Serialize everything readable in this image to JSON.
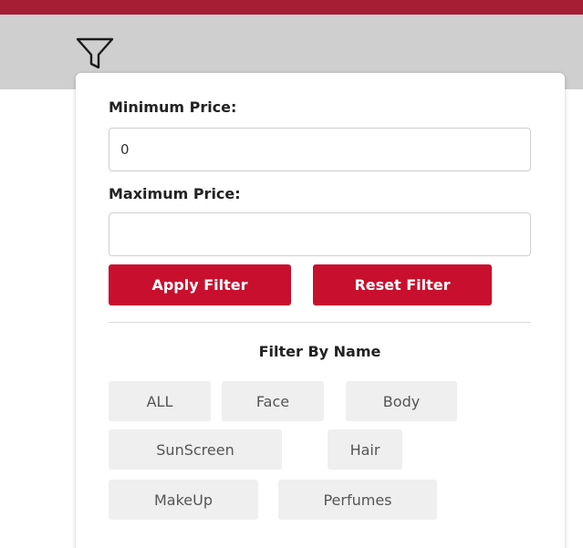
{
  "header": {
    "filter_icon": "filter-funnel-icon"
  },
  "price_filter": {
    "min_label": "Minimum Price:",
    "min_value": "0",
    "max_label": "Maximum Price:",
    "max_value": "",
    "apply_label": "Apply Filter",
    "reset_label": "Reset Filter"
  },
  "name_filter": {
    "title": "Filter By Name",
    "categories": [
      "ALL",
      "Face",
      "Body",
      "SunScreen",
      "Hair",
      "MakeUp",
      "Perfumes"
    ]
  },
  "colors": {
    "accent": "#c8102e",
    "top_bar": "#a61e34",
    "header_bg": "#cfcfcf",
    "chip_bg": "#efefef"
  }
}
